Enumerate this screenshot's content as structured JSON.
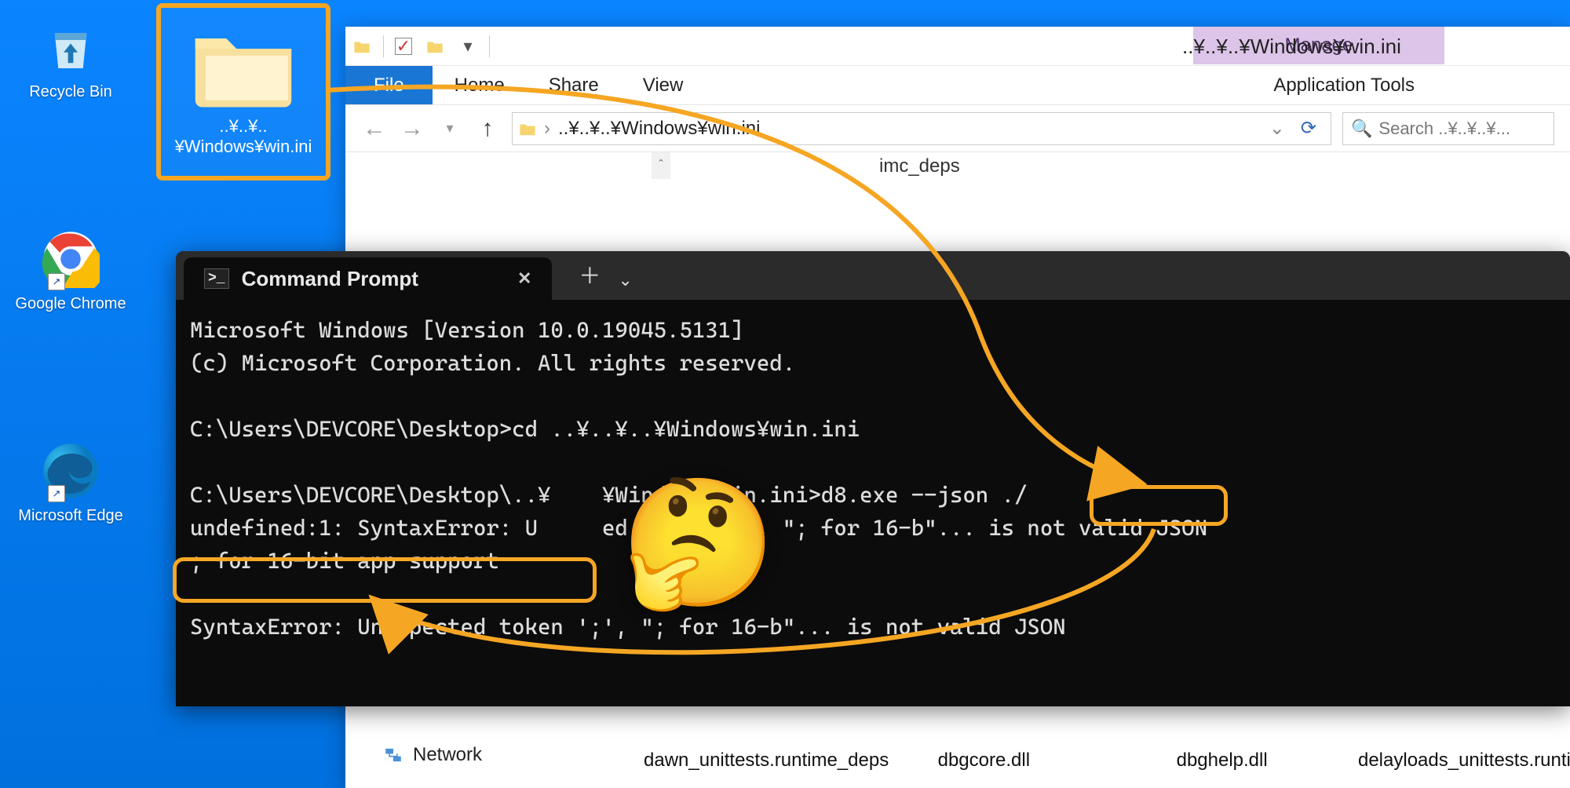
{
  "desktop": {
    "recycle_bin": "Recycle Bin",
    "chrome": "Google Chrome",
    "edge": "Microsoft Edge",
    "highlighted_folder": "..¥..¥..¥Windows¥win.ini"
  },
  "explorer": {
    "window_title": "..¥..¥..¥Windows¥win.ini",
    "context_header": "Manage",
    "context_sub": "Application Tools",
    "tabs": {
      "file": "File",
      "home": "Home",
      "share": "Share",
      "view": "View"
    },
    "breadcrumb": "..¥..¥..¥Windows¥win.ini",
    "search_placeholder": "Search ..¥..¥..¥...",
    "partial_top_item": "imc_deps",
    "sidebar_network": "Network",
    "files": [
      "dawn_unittests.runtime_deps",
      "dbgcore.dll",
      "dbghelp.dll",
      "delayloads_unittests.runtime_dep"
    ]
  },
  "terminal": {
    "tab_title": "Command Prompt",
    "lines": {
      "l1": "Microsoft Windows [Version 10.0.19045.5131]",
      "l2": "(c) Microsoft Corporation. All rights reserved.",
      "l3": "",
      "l4": "C:\\Users\\DEVCORE\\Desktop>cd ..¥..¥..¥Windows¥win.ini",
      "l5": "",
      "l6": "C:\\Users\\DEVCORE\\Desktop\\..¥    ¥Windows¥win.ini>d8.exe --json ./",
      "l7": "undefined:1: SyntaxError: U     ed token ';', \"; for 16-b\"... is not valid JSON",
      "l8": "; for 16-bit app support",
      "l9": "",
      "l10": "SyntaxError: Unexpected token ';', \"; for 16-b\"... is not valid JSON"
    }
  },
  "annotations": {
    "highlight_json_flag": "--json ./",
    "highlight_16bit": "; for 16-bit app support",
    "emoji": "🤔"
  }
}
